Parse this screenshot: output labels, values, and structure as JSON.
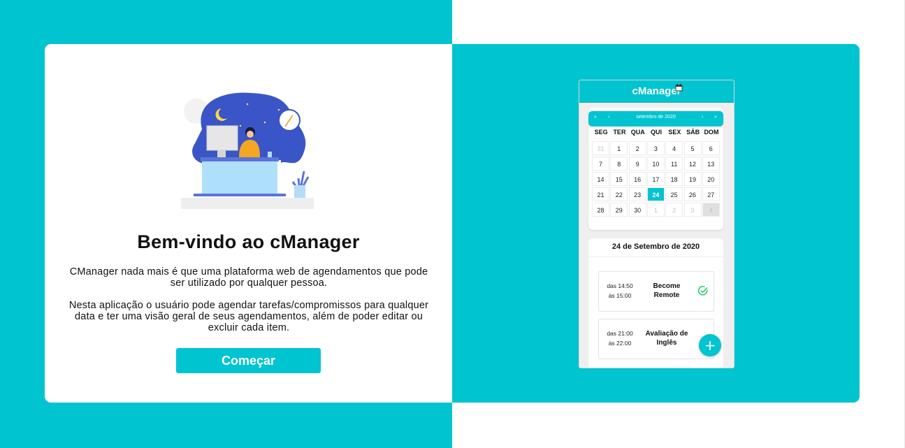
{
  "colors": {
    "accent": "#00c4d0",
    "card": "#ffffff",
    "text": "#111111",
    "success": "#2ecc71"
  },
  "welcome": {
    "title": "Bem-vindo ao cManager",
    "paragraph1": "CManager nada mais é que uma plataforma web de agendamentos que pode ser utilizado por qualquer pessoa.",
    "paragraph2": "Nesta aplicação o usuário pode agendar tarefas/compromissos para qualquer data e ter uma visão geral de seus agendamentos, além de poder editar ou excluir cada item.",
    "start_button": "Começar"
  },
  "preview": {
    "app_title": "cManager",
    "calendar": {
      "month_label": "setembro de 2020",
      "nav": {
        "prev_year": "«",
        "prev_month": "‹",
        "next_month": "›",
        "next_year": "»"
      },
      "weekdays": [
        "SEG",
        "TER",
        "QUA",
        "QUI",
        "SEX",
        "SÁB",
        "DOM"
      ],
      "weeks": [
        [
          "31",
          "1",
          "2",
          "3",
          "4",
          "5",
          "6"
        ],
        [
          "7",
          "8",
          "9",
          "10",
          "11",
          "12",
          "13"
        ],
        [
          "14",
          "15",
          "16",
          "17",
          "18",
          "19",
          "20"
        ],
        [
          "21",
          "22",
          "23",
          "24",
          "25",
          "26",
          "27"
        ],
        [
          "28",
          "29",
          "30",
          "1",
          "2",
          "3",
          "4"
        ]
      ],
      "selected_day": "24"
    },
    "schedule": {
      "date_title": "24 de Setembro de 2020",
      "events": [
        {
          "time_start": "das 14:50",
          "time_end": "às 15:00",
          "title_line1": "Become",
          "title_line2": "Remote",
          "status_icon": "check-circle-icon"
        },
        {
          "time_start": "das 21:00",
          "time_end": "às 22:00",
          "title_line1": "Avaliação de",
          "title_line2": "Inglês",
          "status_icon": "check-circle-icon"
        }
      ],
      "fab_label": "+"
    }
  }
}
